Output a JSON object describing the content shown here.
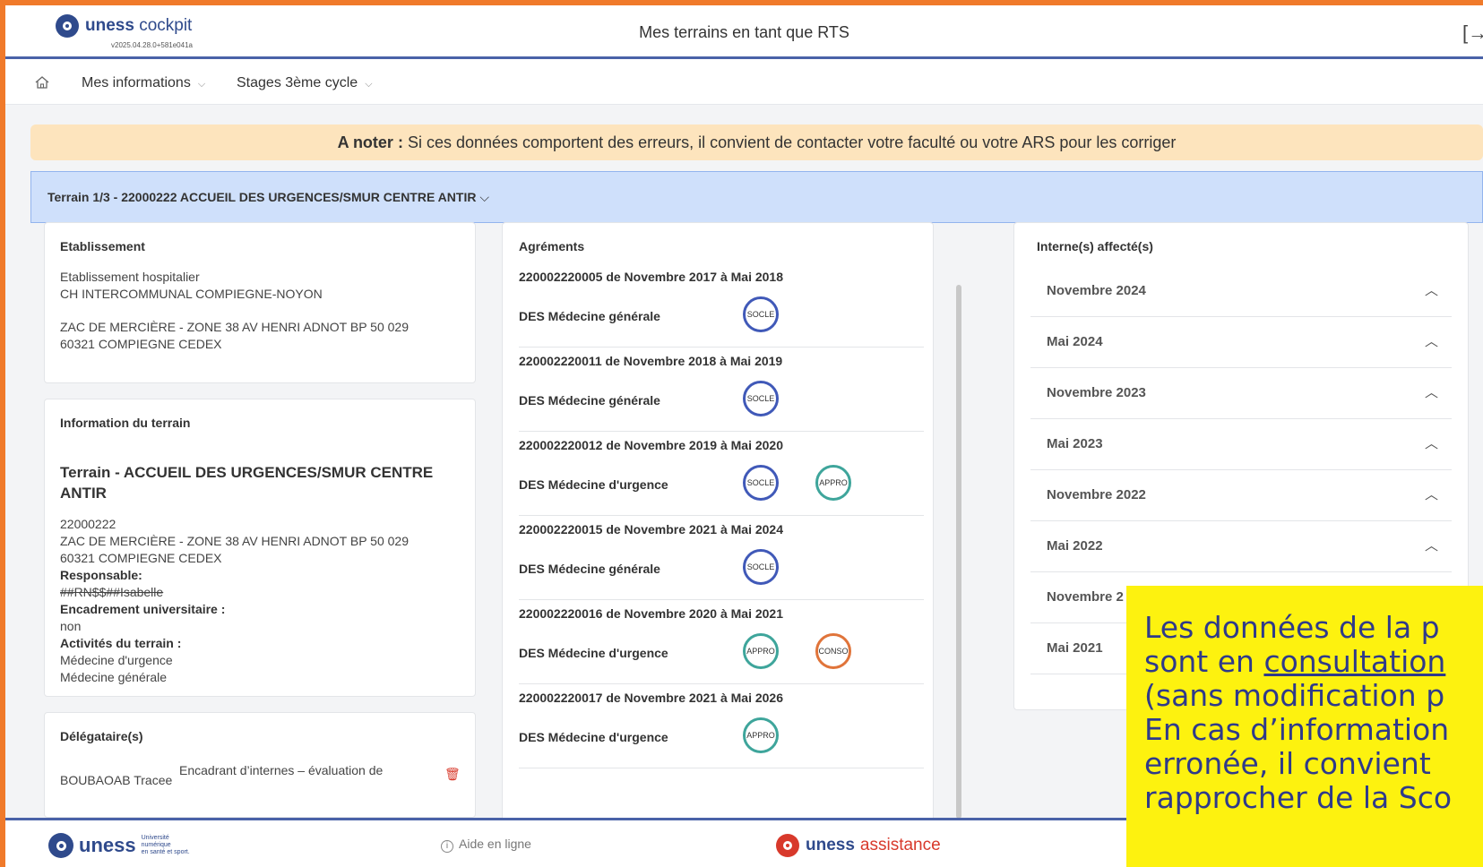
{
  "header": {
    "logo_bold": "uness",
    "logo_light": "cockpit",
    "version": "v2025.04.28.0+581e041a",
    "title": "Mes terrains en tant que RTS",
    "logout_icon": "logout-icon"
  },
  "nav": {
    "items": [
      {
        "label": "Mes informations"
      },
      {
        "label": "Stages 3ème cycle"
      }
    ]
  },
  "notice": {
    "prefix": "A noter :",
    "text": "Si ces données comportent des erreurs, il convient de contacter votre faculté ou votre ARS pour les corriger"
  },
  "terrain": {
    "title": "Terrain 1/3 - 22000222 ACCUEIL DES URGENCES/SMUR CENTRE ANTIR"
  },
  "etablissement": {
    "heading": "Etablissement",
    "type": "Etablissement hospitalier",
    "name": "CH INTERCOMMUNAL COMPIEGNE-NOYON",
    "address1": "ZAC DE MERCIÈRE - ZONE 38 AV HENRI ADNOT BP 50 029",
    "address2": "60321 COMPIEGNE CEDEX"
  },
  "info": {
    "heading": "Information du terrain",
    "title": "Terrain - ACCUEIL DES URGENCES/SMUR CENTRE ANTIR",
    "code": "22000222",
    "address1": "ZAC DE MERCIÈRE - ZONE 38 AV HENRI ADNOT BP 50 029",
    "address2": "60321 COMPIEGNE CEDEX",
    "responsable_label": "Responsable:",
    "responsable_value": "##RN$$##Isabelle",
    "encadrement_label": "Encadrement universitaire :",
    "encadrement_value": "non",
    "activites_label": "Activités du terrain :",
    "activites": [
      "Médecine d'urgence",
      "Médecine générale"
    ]
  },
  "delegataires": {
    "heading": "Délégataire(s)",
    "name": "BOUBAOAB Tracee",
    "role": "Encadrant d’internes – évaluation de"
  },
  "agrements": {
    "heading": "Agréments",
    "items": [
      {
        "header": "220002220005 de Novembre 2017 à Mai 2018",
        "des": "DES Médecine générale",
        "badges": [
          "SOCLE"
        ]
      },
      {
        "header": "220002220011 de Novembre 2018 à Mai 2019",
        "des": "DES Médecine générale",
        "badges": [
          "SOCLE"
        ]
      },
      {
        "header": "220002220012 de Novembre 2019 à Mai 2020",
        "des": "DES Médecine d'urgence",
        "badges": [
          "SOCLE",
          "APPRO"
        ]
      },
      {
        "header": "220002220015 de Novembre 2021 à Mai 2024",
        "des": "DES Médecine générale",
        "badges": [
          "SOCLE"
        ]
      },
      {
        "header": "220002220016 de Novembre 2020 à Mai 2021",
        "des": "DES Médecine d'urgence",
        "badges": [
          "APPRO",
          "CONSO"
        ]
      },
      {
        "header": "220002220017 de Novembre 2021 à Mai 2026",
        "des": "DES Médecine d'urgence",
        "badges": [
          "APPRO"
        ]
      }
    ]
  },
  "internes": {
    "heading": "Interne(s) affecté(s)",
    "periods": [
      "Novembre 2024",
      "Mai 2024",
      "Novembre 2023",
      "Mai 2023",
      "Novembre 2022",
      "Mai 2022",
      "Novembre 2",
      "Mai 2021"
    ]
  },
  "footer": {
    "logo": "uness",
    "logo_sub1": "Université",
    "logo_sub2": "numérique",
    "logo_sub3": "en santé et sport.",
    "help": "Aide en ligne",
    "assist_bold": "uness",
    "assist_light": "assistance"
  },
  "overlay": {
    "line1": "Les données de la p",
    "line2_a": "sont en ",
    "line2_b": "consultation",
    "line3": "(sans modification p",
    "line4": "En cas d’information",
    "line5": "erronée, il convient",
    "line6": "rapprocher de la Sco"
  }
}
